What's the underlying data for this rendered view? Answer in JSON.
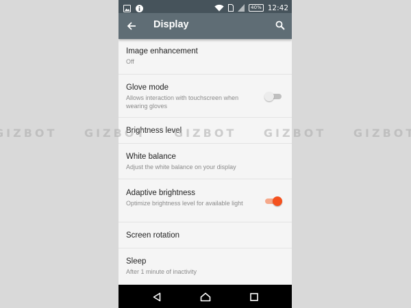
{
  "status_bar": {
    "battery": "40%",
    "time": "12:42",
    "icons": [
      "image-icon",
      "info-icon",
      "wifi-icon",
      "sim-icon",
      "signal-icon",
      "battery-icon"
    ]
  },
  "app_bar": {
    "title": "Display",
    "icons": [
      "back-arrow-icon",
      "search-icon"
    ]
  },
  "settings": [
    {
      "title": "Image enhancement",
      "summary": "Off"
    },
    {
      "title": "Glove mode",
      "summary": "Allows interaction with touchscreen when wearing gloves",
      "toggle": false
    },
    {
      "title": "Brightness level"
    },
    {
      "title": "White balance",
      "summary": "Adjust the white balance on your display"
    },
    {
      "title": "Adaptive brightness",
      "summary": "Optimize brightness level for available light",
      "toggle": true
    },
    {
      "title": "Screen rotation"
    },
    {
      "title": "Sleep",
      "summary": "After 1 minute of inactivity"
    }
  ],
  "nav_bar": {
    "icons": [
      "back-triangle-icon",
      "home-icon",
      "recents-icon"
    ]
  },
  "watermark": {
    "text": "GIZBOT GIZBOT GIZBOT GIZBOT GIZBOT"
  },
  "colors": {
    "status_bar": "#46535b",
    "app_bar": "#5f6d75",
    "accent": "#f4511e",
    "background": "#f5f5f5"
  }
}
